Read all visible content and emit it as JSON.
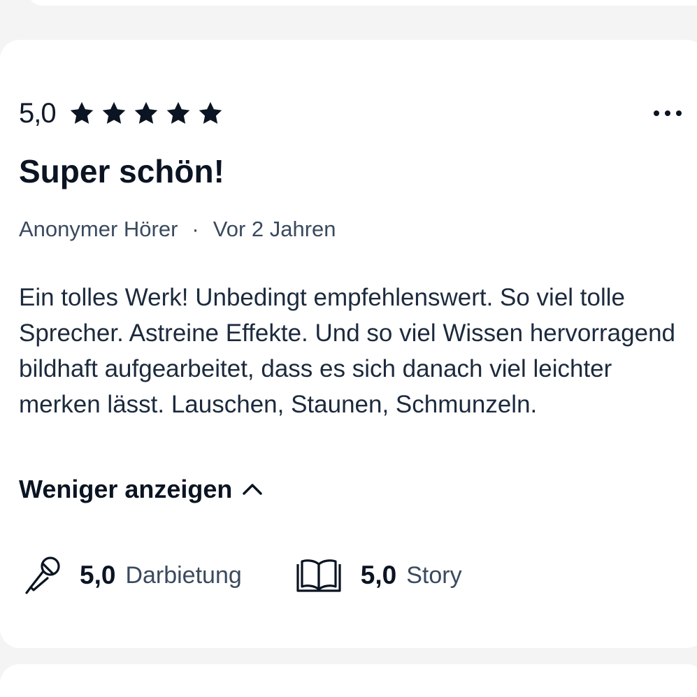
{
  "review": {
    "rating": "5,0",
    "stars": 5,
    "title": "Super schön!",
    "author": "Anonymer Hörer",
    "separator": "·",
    "date": "Vor 2 Jahren",
    "text": "Ein tolles Werk! Unbedingt empfehlenswert. So viel tolle Sprecher. Astreine Effekte. Und so viel Wissen hervorragend bildhaft aufgearbeitet, dass es sich danach viel leichter merken lässt. Lauschen, Staunen, Schmunzeln.",
    "toggle_label": "Weniger anzeigen"
  },
  "sub_ratings": {
    "performance": {
      "value": "5,0",
      "label": "Darbietung",
      "icon": "microphone-icon"
    },
    "story": {
      "value": "5,0",
      "label": "Story",
      "icon": "open-book-icon"
    }
  },
  "colors": {
    "primary_text": "#0b1422",
    "secondary_text": "#3a4a5e",
    "card_bg": "#ffffff",
    "page_bg": "#f4f4f4"
  }
}
